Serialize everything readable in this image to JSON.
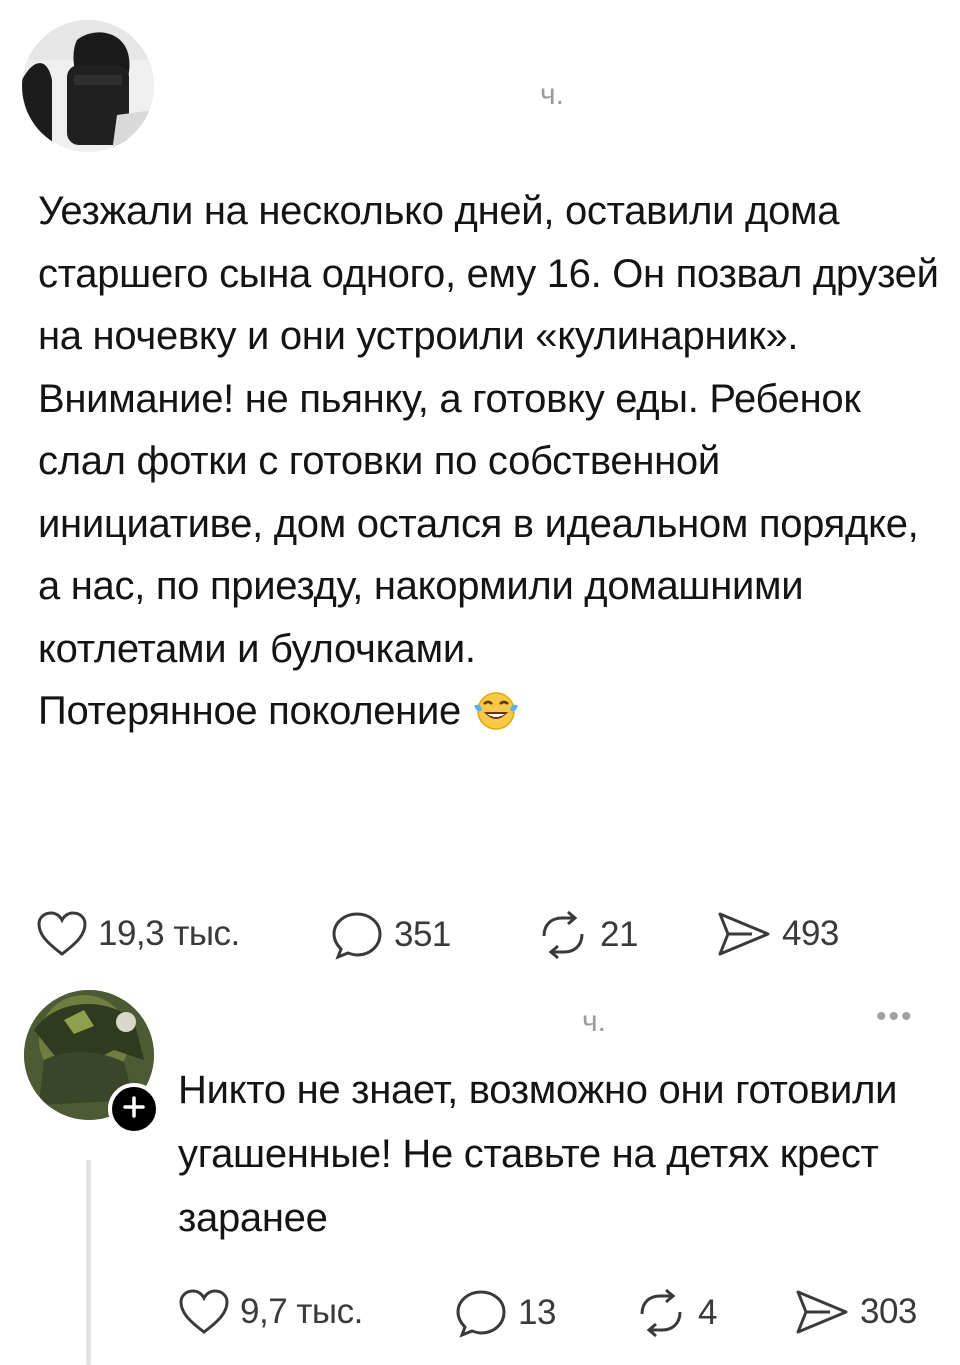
{
  "post": {
    "time": "ч.",
    "text": "Уезжали на несколько дней, оставили дома старшего сына одного, ему 16. Он позвал друзей на ночевку и они устроили «кулинарник».\nВнимание! не пьянку, а готовку еды. Ребенок слал фотки с готовки по собственной инициативе, дом остался в идеальном порядке, а нас, по приезду, накормили домашними котлетами и булочками.\nПотерянное поколение",
    "emoji_icon": "tears-of-joy-emoji",
    "actions": {
      "likes": "19,3 тыс.",
      "comments": "351",
      "reposts": "21",
      "shares": "493"
    }
  },
  "reply": {
    "time": "ч.",
    "more": "•••",
    "text": "Никто не знает, возможно они готовили угашенные! Не ставьте на детях крест заранее",
    "actions": {
      "likes": "9,7 тыс.",
      "comments": "13",
      "reposts": "4",
      "shares": "303"
    }
  },
  "colors": {
    "text": "#141414",
    "muted": "#9a9a9a",
    "icon": "#3a3a3a",
    "thread_line": "#e3e3e3"
  }
}
